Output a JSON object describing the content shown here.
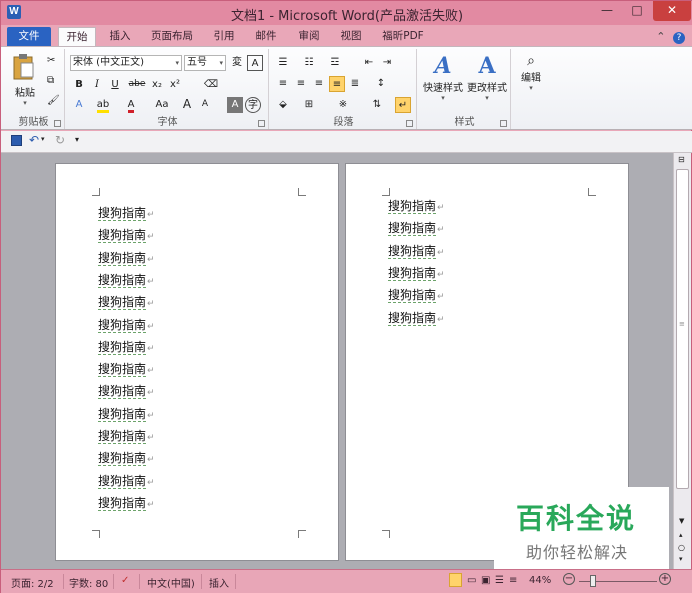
{
  "window": {
    "title": "文档1 - Microsoft Word(产品激活失败)",
    "app_icon": "W",
    "controls": {
      "minimize": "—",
      "maximize": "□",
      "close": "✕"
    }
  },
  "tabs": [
    "文件",
    "开始",
    "插入",
    "页面布局",
    "引用",
    "邮件",
    "审阅",
    "视图",
    "福昕PDF"
  ],
  "ribbon": {
    "clipboard": {
      "paste_label": "粘贴",
      "group_label": "剪贴板"
    },
    "font": {
      "font_name": "宋体 (中文正文)",
      "font_size": "五号",
      "bold": "B",
      "italic": "I",
      "underline": "U",
      "strike": "abe",
      "subscript": "x₂",
      "superscript": "x²",
      "grow": "A",
      "shrink": "A",
      "change_case": "Aa",
      "group_label": "字体"
    },
    "paragraph": {
      "group_label": "段落"
    },
    "styles": {
      "quick_styles": "快速样式",
      "change_styles": "更改样式",
      "group_label": "样式"
    },
    "editing": {
      "label": "编辑"
    }
  },
  "document": {
    "page1_lines": [
      "搜狗指南",
      "搜狗指南",
      "搜狗指南",
      "搜狗指南",
      "搜狗指南",
      "搜狗指南",
      "搜狗指南",
      "搜狗指南",
      "搜狗指南",
      "搜狗指南",
      "搜狗指南",
      "搜狗指南",
      "搜狗指南",
      "搜狗指南"
    ],
    "page2_lines": [
      "搜狗指南",
      "搜狗指南",
      "搜狗指南",
      "搜狗指南",
      "搜狗指南",
      "搜狗指南"
    ],
    "paragraph_mark": "↵"
  },
  "watermark": {
    "title": "百科全说",
    "subtitle": "助你轻松解决"
  },
  "statusbar": {
    "page": "页面: 2/2",
    "words": "字数: 80",
    "language": "中文(中国)",
    "mode": "插入",
    "zoom": "44%"
  },
  "colors": {
    "title_bar": "#e28aa2",
    "file_tab": "#2a63c2",
    "watermark_green": "#29a85a"
  }
}
